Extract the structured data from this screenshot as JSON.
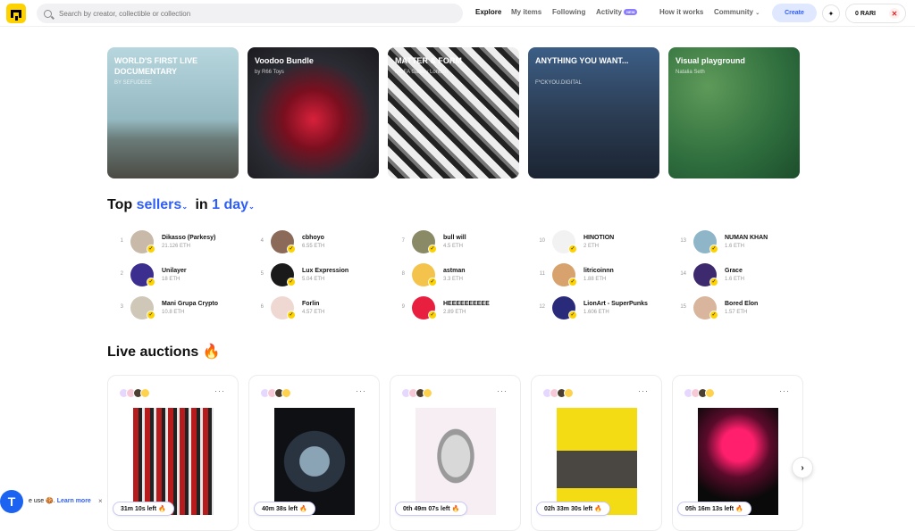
{
  "header": {
    "search_placeholder": "Search by creator, collectible or collection",
    "nav": [
      "Explore",
      "My items",
      "Following",
      "Activity",
      "How it works",
      "Community"
    ],
    "new_badge": "NEW",
    "create_label": "Create",
    "balance": "0 RARI",
    "chevron": "⌄",
    "spark": "✦"
  },
  "banners": [
    {
      "title": "WORLD'S FIRST LIVE DOCUMENTARY",
      "subtitle": "BY SEFUDEEE"
    },
    {
      "title": "Voodoo Bundle",
      "subtitle": "by R66 Toys"
    },
    {
      "title": "MATTER & FORM",
      "subtitle": "MOFA Gallery London"
    },
    {
      "title": "ANYTHING YOU WANT...",
      "subtitle": "F*CKYOU.DIGITAL"
    },
    {
      "title": "Visual playground",
      "subtitle": "Natalia Seth"
    }
  ],
  "top_sellers": {
    "title_prefix": "Top",
    "title_highlight": "sellers",
    "title_in": "in",
    "period": "1 day",
    "chevron": "⌄",
    "items": [
      {
        "rank": "1",
        "name": "Dikasso (Parkesy)",
        "value": "21.126 ETH"
      },
      {
        "rank": "2",
        "name": "Unilayer",
        "value": "18 ETH"
      },
      {
        "rank": "3",
        "name": "Mani Grupa Crypto",
        "value": "10.8 ETH"
      },
      {
        "rank": "4",
        "name": "cbhoyo",
        "value": "6.55 ETH"
      },
      {
        "rank": "5",
        "name": "Lux Expression",
        "value": "5.04 ETH"
      },
      {
        "rank": "6",
        "name": "Forlin",
        "value": "4.57 ETH"
      },
      {
        "rank": "7",
        "name": "bull will",
        "value": "4.5 ETH"
      },
      {
        "rank": "8",
        "name": "astman",
        "value": "3.3 ETH"
      },
      {
        "rank": "9",
        "name": "HEEEEEEEEEE",
        "value": "2.89 ETH"
      },
      {
        "rank": "10",
        "name": "HINOTION",
        "value": "2 ETH"
      },
      {
        "rank": "11",
        "name": "litricoinnn",
        "value": "1.88 ETH"
      },
      {
        "rank": "12",
        "name": "LionArt - SuperPunks",
        "value": "1.606 ETH"
      },
      {
        "rank": "13",
        "name": "NUMAN KHAN",
        "value": "1.6 ETH"
      },
      {
        "rank": "14",
        "name": "Grace",
        "value": "1.6 ETH"
      },
      {
        "rank": "15",
        "name": "Bored Elon",
        "value": "1.57 ETH"
      }
    ],
    "verified_glyph": "✓"
  },
  "live_auctions": {
    "title": "Live auctions",
    "emoji": "🔥",
    "more_glyph": "···",
    "items": [
      {
        "timer": "31m  10s  left",
        "emoji": "🔥"
      },
      {
        "timer": "40m 38s  left",
        "emoji": "🔥"
      },
      {
        "timer": "0th 49m 07s  left",
        "emoji": "🔥"
      },
      {
        "timer": "02h 33m 30s  left",
        "emoji": "🔥"
      },
      {
        "timer": "05h 16m  13s  left",
        "emoji": "🔥"
      }
    ],
    "next_glyph": "›"
  },
  "cookie": {
    "logo": "T",
    "text": "e use 🍪.",
    "link": "Learn more",
    "close": "×"
  },
  "colors": {
    "accent": "#2f5ff6",
    "brand_yellow": "#fed200"
  }
}
